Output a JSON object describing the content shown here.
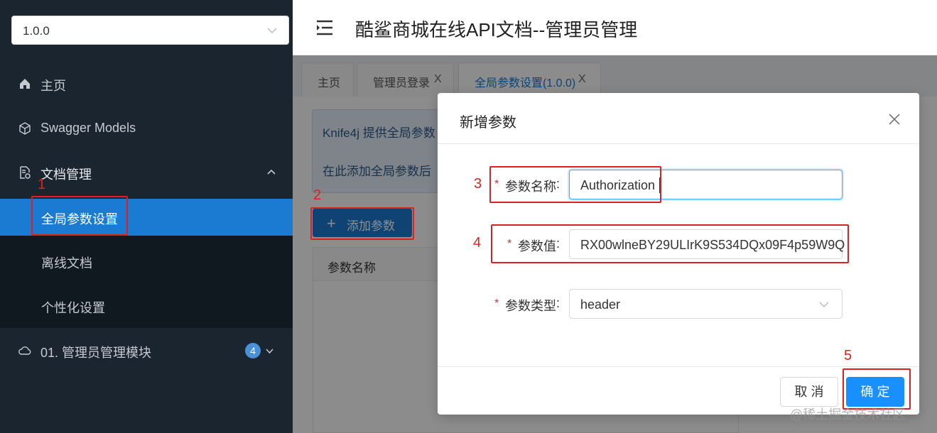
{
  "sidebar": {
    "version": "1.0.0",
    "items": [
      {
        "label": "主页",
        "icon": "home-icon"
      },
      {
        "label": "Swagger Models",
        "icon": "cube-icon"
      },
      {
        "label": "文档管理",
        "icon": "doc-settings-icon"
      },
      {
        "label": "全局参数设置"
      },
      {
        "label": "离线文档"
      },
      {
        "label": "个性化设置"
      },
      {
        "label": "01. 管理员管理模块",
        "icon": "cloud-icon",
        "badge": "4"
      }
    ]
  },
  "header": {
    "title": "酷鲨商城在线API文档--管理员管理"
  },
  "tabs": [
    {
      "label": "主页"
    },
    {
      "label": "管理员登录",
      "close": "X"
    },
    {
      "label": "全局参数设置(1.0.0)",
      "close": "X"
    }
  ],
  "content": {
    "info_line1": "Knife4j 提供全局参数",
    "info_line2": "在此添加全局参数后",
    "add_button": "添加参数",
    "table_header": "参数名称"
  },
  "modal": {
    "title": "新增参数",
    "fields": [
      {
        "label": "参数名称",
        "value": "Authorization"
      },
      {
        "label": "参数值",
        "value": "RX00wlneBY29ULIrK9S534DQx09F4p59W9Q"
      },
      {
        "label": "参数类型",
        "value": "header"
      }
    ],
    "cancel": "取 消",
    "ok": "确 定"
  },
  "annotations": [
    "1",
    "2",
    "3",
    "4",
    "5"
  ],
  "watermark": "@稀土掘金技术社区",
  "colors": {
    "accent": "#1890ff",
    "sidebar_bg": "#1a2530",
    "annotation": "#e02020"
  }
}
